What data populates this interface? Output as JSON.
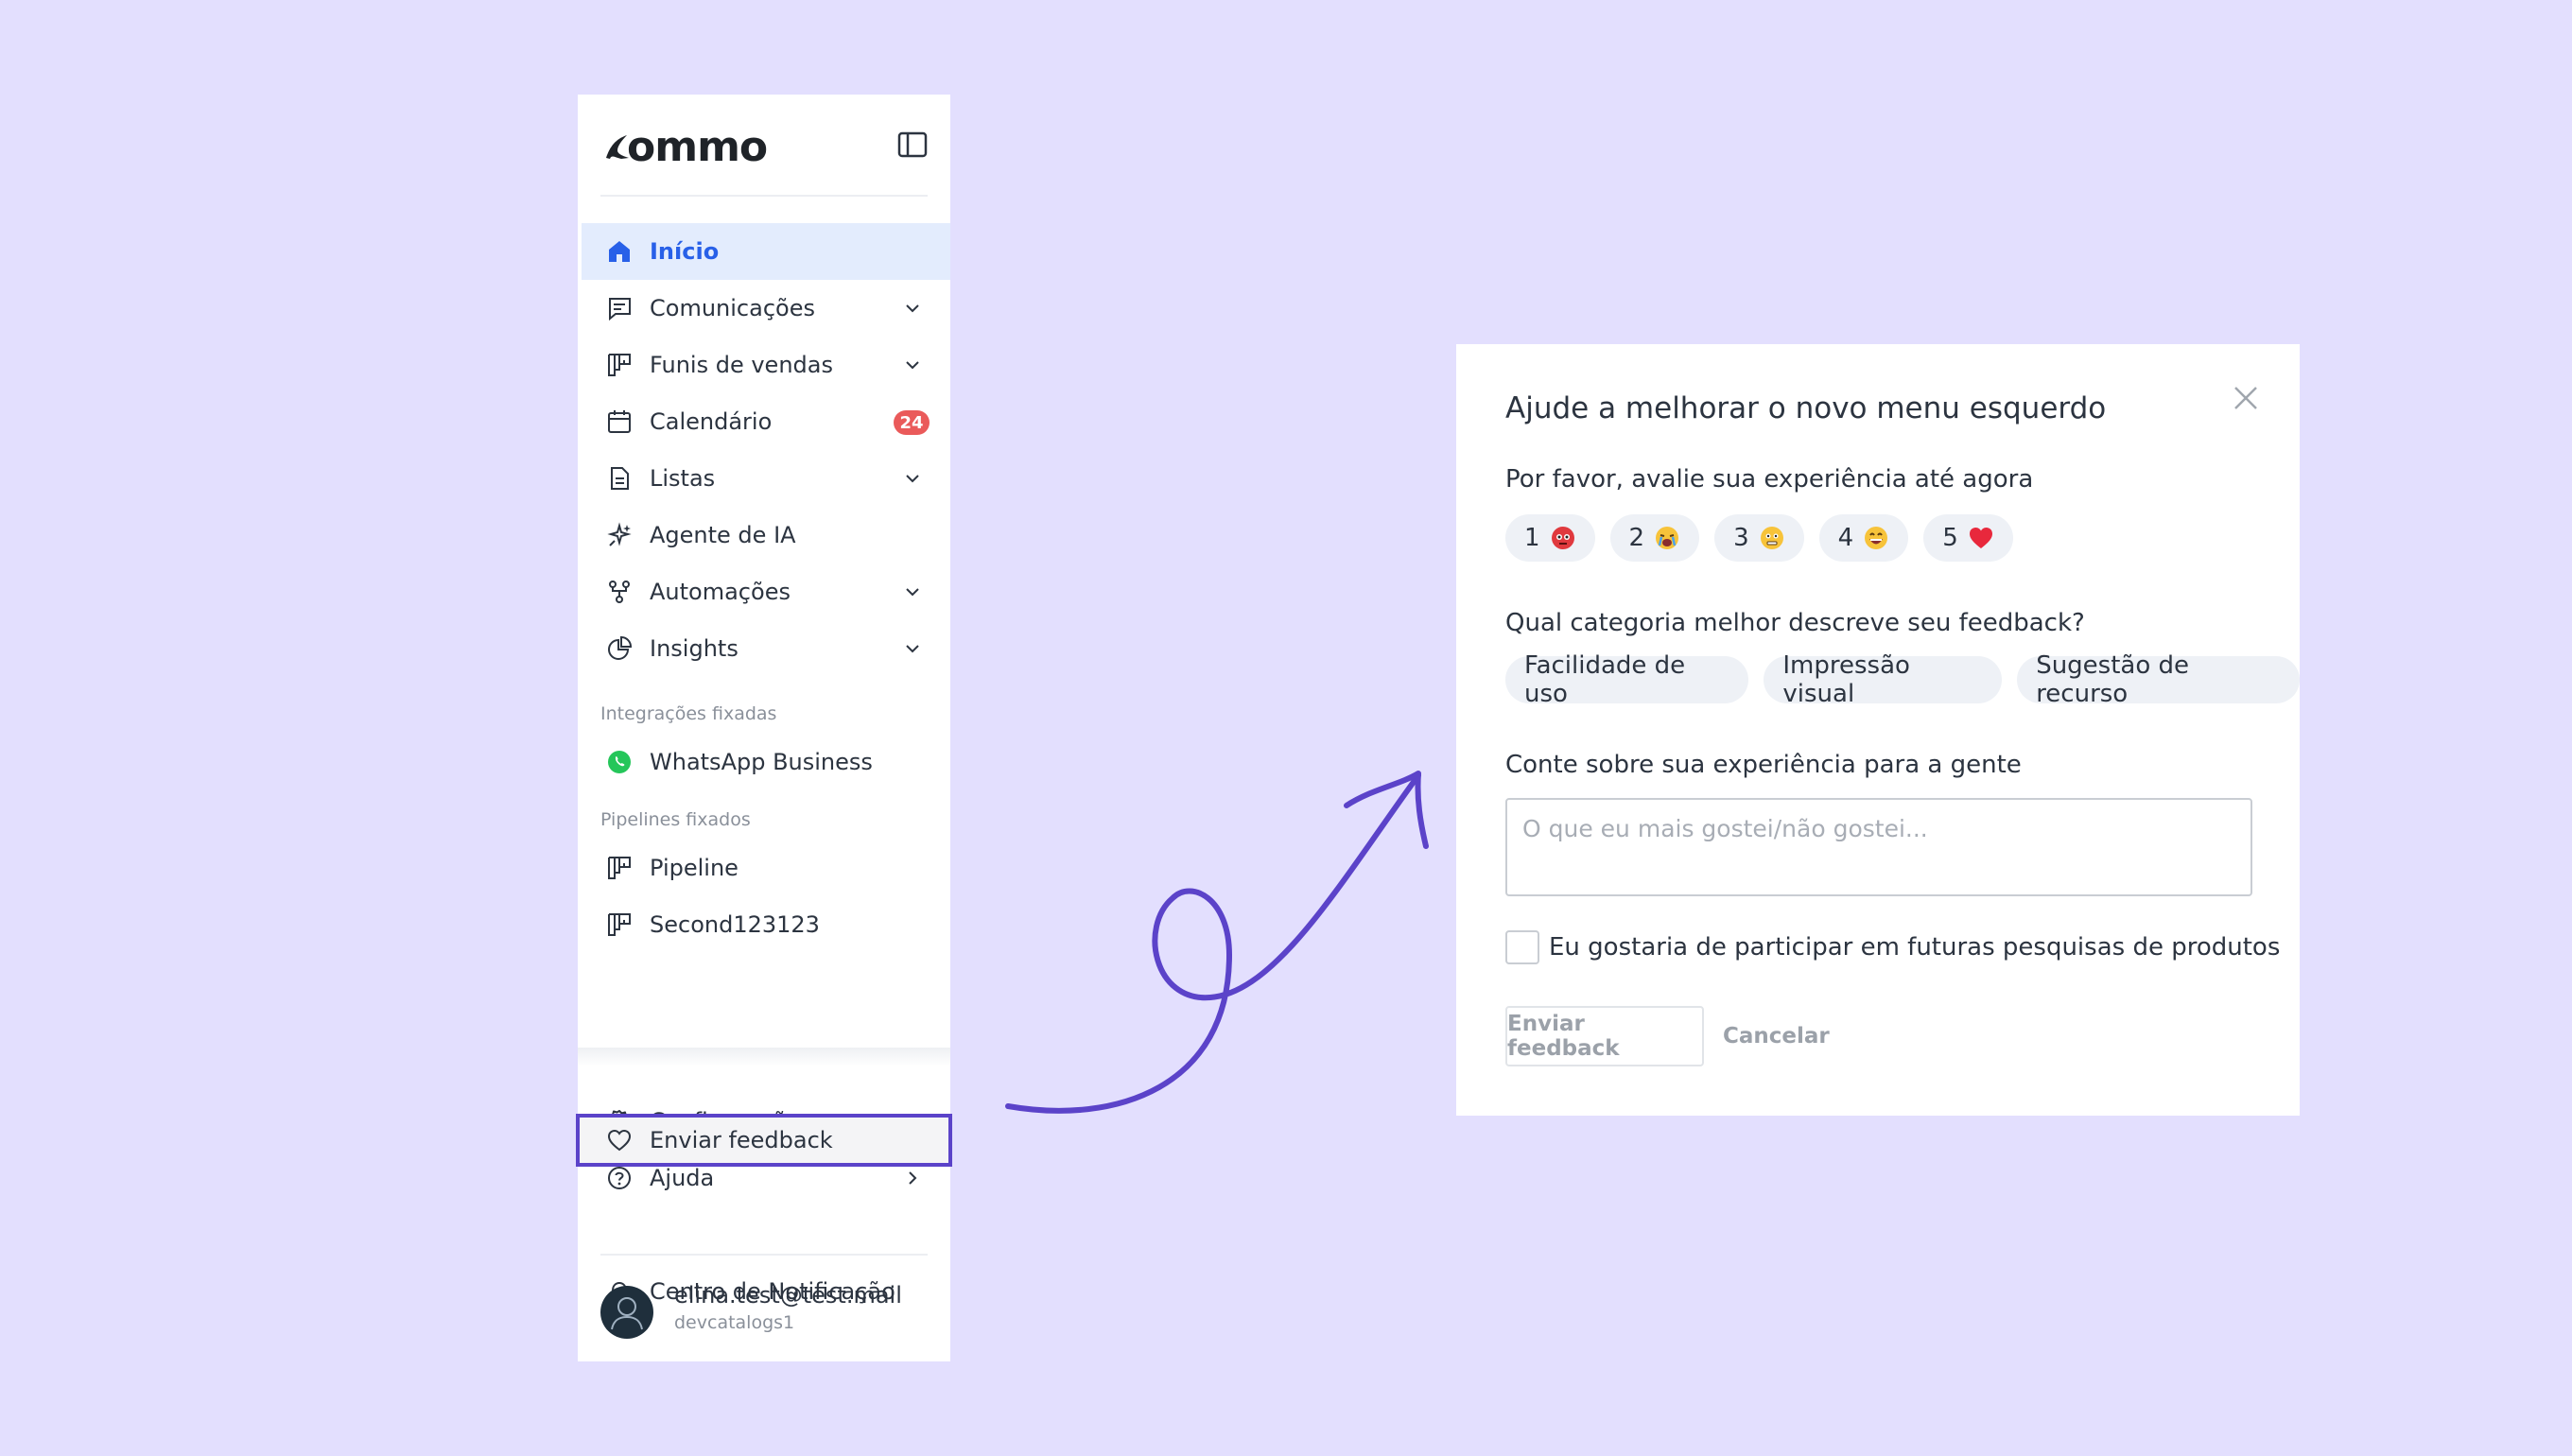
{
  "colors": {
    "background": "#e3dffe",
    "accent": "#2860e8",
    "highlight_border": "#5b43c9",
    "badge": "#ea5a5a",
    "whatsapp": "#25c65a"
  },
  "sidebar": {
    "logo_text": "ommo",
    "collapse_icon": "sidebar-toggle-icon",
    "items": [
      {
        "label": "Início",
        "icon": "home-icon",
        "active": true
      },
      {
        "label": "Comunicações",
        "icon": "chat-icon",
        "expandable": true
      },
      {
        "label": "Funis de vendas",
        "icon": "pipeline-icon",
        "expandable": true
      },
      {
        "label": "Calendário",
        "icon": "calendar-icon",
        "badge": "24"
      },
      {
        "label": "Listas",
        "icon": "document-icon",
        "expandable": true
      },
      {
        "label": "Agente de IA",
        "icon": "sparkles-icon"
      },
      {
        "label": "Automações",
        "icon": "automation-icon",
        "expandable": true
      },
      {
        "label": "Insights",
        "icon": "pie-chart-icon",
        "expandable": true
      }
    ],
    "pinned_integrations_label": "Integrações fixadas",
    "pinned_integrations": [
      {
        "label": "WhatsApp Business",
        "icon": "whatsapp-icon"
      }
    ],
    "pinned_pipelines_label": "Pipelines fixados",
    "pinned_pipelines": [
      {
        "label": "Pipeline",
        "icon": "pipeline-icon"
      },
      {
        "label": "Second123123",
        "icon": "pipeline-icon"
      }
    ],
    "bottom_items": [
      {
        "label": "Configurações",
        "icon": "gear-icon"
      },
      {
        "label": "Ajuda",
        "icon": "help-icon",
        "submenu": true
      },
      {
        "label": "Enviar feedback",
        "icon": "heart-icon",
        "highlighted": true
      },
      {
        "label": "Centro de Notificação",
        "icon": "bell-icon"
      }
    ],
    "user": {
      "email": "elina.test@test.mail",
      "account": "devcatalogs1"
    }
  },
  "modal": {
    "title": "Ajude a melhorar o novo menu esquerdo",
    "rating_question": "Por favor, avalie sua experiência até agora",
    "ratings": [
      {
        "value": "1",
        "emoji": "angry-face-icon"
      },
      {
        "value": "2",
        "emoji": "crying-face-icon"
      },
      {
        "value": "3",
        "emoji": "neutral-face-icon"
      },
      {
        "value": "4",
        "emoji": "grinning-face-icon"
      },
      {
        "value": "5",
        "emoji": "red-heart-icon"
      }
    ],
    "category_question": "Qual categoria melhor descreve seu feedback?",
    "categories": [
      "Facilidade de uso",
      "Impressão visual",
      "Sugestão de recurso"
    ],
    "experience_label": "Conte sobre sua experiência para a gente",
    "experience_placeholder": "O que eu mais gostei/não gostei...",
    "survey_checkbox_label": "Eu gostaria de participar em futuras pesquisas de produtos",
    "survey_checkbox_checked": false,
    "submit_label": "Enviar feedback",
    "cancel_label": "Cancelar"
  }
}
